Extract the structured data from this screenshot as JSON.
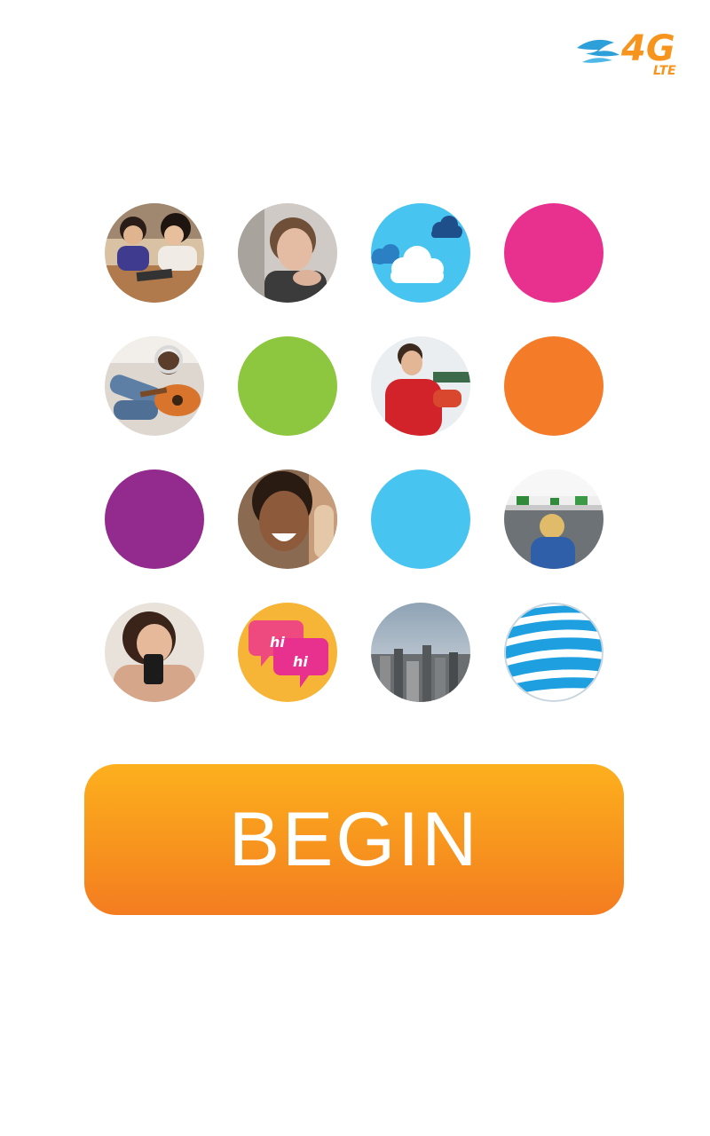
{
  "status": {
    "network": "4G",
    "network_sub": "LTE"
  },
  "grid": {
    "tiles": [
      {
        "name": "photo-kids-tablet",
        "kind": "photo"
      },
      {
        "name": "photo-teen-boy",
        "kind": "photo"
      },
      {
        "name": "cloud-icon-tile",
        "kind": "icon"
      },
      {
        "name": "pink-dot",
        "kind": "color",
        "color": "#e8318f"
      },
      {
        "name": "photo-girl-guitar",
        "kind": "photo"
      },
      {
        "name": "green-dot",
        "kind": "color",
        "color": "#8dc63f"
      },
      {
        "name": "photo-boy-red-shirt",
        "kind": "photo"
      },
      {
        "name": "orange-dot",
        "kind": "color",
        "color": "#f47b28"
      },
      {
        "name": "purple-dot",
        "kind": "color",
        "color": "#932b8e"
      },
      {
        "name": "photo-smiling-woman",
        "kind": "photo"
      },
      {
        "name": "blue-dot",
        "kind": "color",
        "color": "#48c4f0"
      },
      {
        "name": "photo-boy-toys",
        "kind": "photo"
      },
      {
        "name": "photo-woman-phone",
        "kind": "photo"
      },
      {
        "name": "chat-hi-tile",
        "kind": "icon",
        "text1": "hi",
        "text2": "hi"
      },
      {
        "name": "photo-city-skyline",
        "kind": "photo"
      },
      {
        "name": "att-globe-logo",
        "kind": "logo"
      }
    ]
  },
  "begin_button": {
    "label": "BEGIN",
    "color": "#f7941e"
  }
}
